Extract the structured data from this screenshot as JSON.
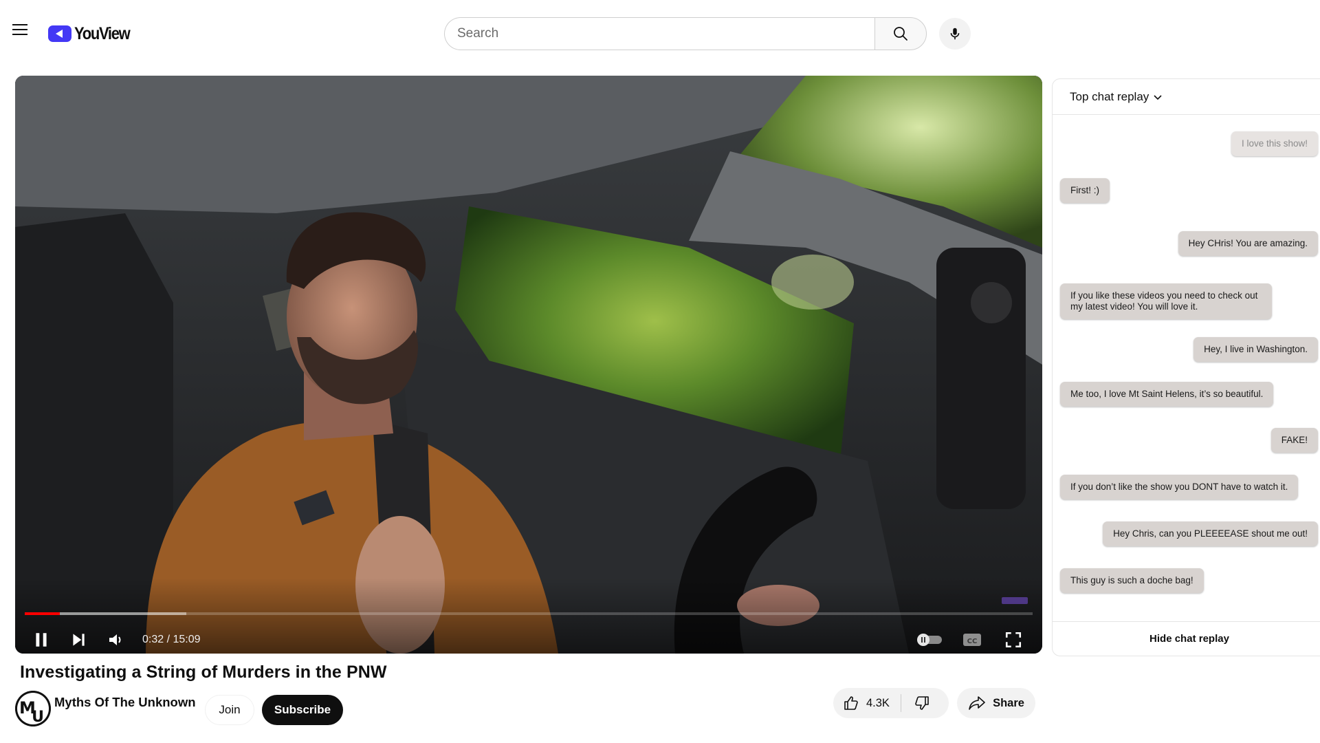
{
  "app": {
    "name": "YouView"
  },
  "search": {
    "placeholder": "Search",
    "value": ""
  },
  "icons": {
    "menu": "hamburger-menu-icon",
    "search": "search-icon",
    "mic": "microphone-icon",
    "pause": "pause-icon",
    "next": "skip-next-icon",
    "volume": "volume-icon",
    "autoplay": "autoplay-toggle-icon",
    "captions": "closed-captions-icon",
    "fullscreen": "fullscreen-icon",
    "like": "thumbs-up-icon",
    "dislike": "thumbs-down-icon",
    "share": "share-arrow-icon",
    "chat_menu": "chevron-down-icon"
  },
  "colors": {
    "brand": "#4338f5",
    "progress": "#ff0000",
    "subscribe_bg": "#0f0f0f",
    "chat_bubble": "#d8d3d0"
  },
  "player": {
    "time_display": "0:32 / 15:09",
    "played_fraction": 0.035,
    "buffered_fraction": 0.16
  },
  "video": {
    "title": "Investigating a String of Murders in the PNW",
    "channel_name": "Myths Of The Unknown",
    "channel_avatar_text": "MU",
    "join_label": "Join",
    "subscribe_label": "Subscribe",
    "like_count": "4.3K",
    "share_label": "Share"
  },
  "chat": {
    "header_label": "Top chat replay",
    "footer_label": "Hide chat replay",
    "messages": [
      {
        "text": "I love this show!",
        "align": "right"
      },
      {
        "text": "First! :)",
        "align": "left"
      },
      {
        "text": "Hey CHris! You are amazing.",
        "align": "right"
      },
      {
        "text": "If you like these videos you need to check out my latest video!  You will love it.",
        "align": "left"
      },
      {
        "text": "Hey, I live in Washington.",
        "align": "right"
      },
      {
        "text": "Me too, I love Mt Saint Helens, it’s so beautiful.",
        "align": "left"
      },
      {
        "text": "FAKE!",
        "align": "right"
      },
      {
        "text": "If you don’t like the show you DONT have to watch it.",
        "align": "left"
      },
      {
        "text": "Hey Chris, can you PLEEEEASE shout me out!",
        "align": "right"
      },
      {
        "text": "This guy is such a doche bag!",
        "align": "left"
      }
    ]
  }
}
